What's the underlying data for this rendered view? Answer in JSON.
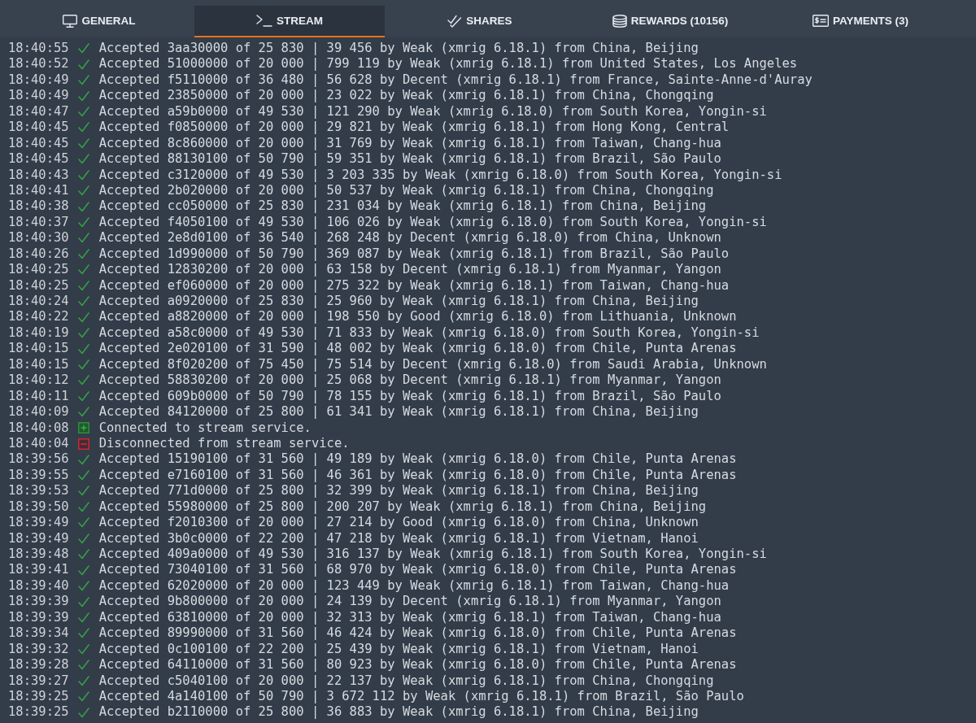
{
  "tabs": [
    {
      "label": "GENERAL",
      "selected": false
    },
    {
      "label": "STREAM",
      "selected": true
    },
    {
      "label": "SHARES",
      "selected": false
    },
    {
      "label": "REWARDS (10156)",
      "selected": false
    },
    {
      "label": "PAYMENTS (3)",
      "selected": false
    }
  ],
  "log": [
    {
      "time": "18:40:55",
      "kind": "accepted",
      "message": "Accepted 3aa30000 of 25 830 | 39 456 by Weak (xmrig 6.18.1) from China, Beijing"
    },
    {
      "time": "18:40:52",
      "kind": "accepted",
      "message": "Accepted 51000000 of 20 000 | 799 119 by Weak (xmrig 6.18.1) from United States, Los Angeles"
    },
    {
      "time": "18:40:49",
      "kind": "accepted",
      "message": "Accepted f5110000 of 36 480 | 56 628 by Decent (xmrig 6.18.1) from France, Sainte-Anne-d'Auray"
    },
    {
      "time": "18:40:49",
      "kind": "accepted",
      "message": "Accepted 23850000 of 20 000 | 23 022 by Weak (xmrig 6.18.1) from China, Chongqing"
    },
    {
      "time": "18:40:47",
      "kind": "accepted",
      "message": "Accepted a59b0000 of 49 530 | 121 290 by Weak (xmrig 6.18.0) from South Korea, Yongin-si"
    },
    {
      "time": "18:40:45",
      "kind": "accepted",
      "message": "Accepted f0850000 of 20 000 | 29 821 by Weak (xmrig 6.18.1) from Hong Kong, Central"
    },
    {
      "time": "18:40:45",
      "kind": "accepted",
      "message": "Accepted 8c860000 of 20 000 | 31 769 by Weak (xmrig 6.18.1) from Taiwan, Chang-hua"
    },
    {
      "time": "18:40:45",
      "kind": "accepted",
      "message": "Accepted 88130100 of 50 790 | 59 351 by Weak (xmrig 6.18.1) from Brazil, São Paulo"
    },
    {
      "time": "18:40:43",
      "kind": "accepted",
      "message": "Accepted c3120000 of 49 530 | 3 203 335 by Weak (xmrig 6.18.0) from South Korea, Yongin-si"
    },
    {
      "time": "18:40:41",
      "kind": "accepted",
      "message": "Accepted 2b020000 of 20 000 | 50 537 by Weak (xmrig 6.18.1) from China, Chongqing"
    },
    {
      "time": "18:40:38",
      "kind": "accepted",
      "message": "Accepted cc050000 of 25 830 | 231 034 by Weak (xmrig 6.18.1) from China, Beijing"
    },
    {
      "time": "18:40:37",
      "kind": "accepted",
      "message": "Accepted f4050100 of 49 530 | 106 026 by Weak (xmrig 6.18.0) from South Korea, Yongin-si"
    },
    {
      "time": "18:40:30",
      "kind": "accepted",
      "message": "Accepted 2e8d0100 of 36 540 | 268 248 by Decent (xmrig 6.18.0) from China, Unknown"
    },
    {
      "time": "18:40:26",
      "kind": "accepted",
      "message": "Accepted 1d990000 of 50 790 | 369 087 by Weak (xmrig 6.18.1) from Brazil, São Paulo"
    },
    {
      "time": "18:40:25",
      "kind": "accepted",
      "message": "Accepted 12830200 of 20 000 | 63 158 by Decent (xmrig 6.18.1) from Myanmar, Yangon"
    },
    {
      "time": "18:40:25",
      "kind": "accepted",
      "message": "Accepted ef060000 of 20 000 | 275 322 by Weak (xmrig 6.18.1) from Taiwan, Chang-hua"
    },
    {
      "time": "18:40:24",
      "kind": "accepted",
      "message": "Accepted a0920000 of 25 830 | 25 960 by Weak (xmrig 6.18.1) from China, Beijing"
    },
    {
      "time": "18:40:22",
      "kind": "accepted",
      "message": "Accepted a8820000 of 20 000 | 198 550 by Good (xmrig 6.18.0) from Lithuania, Unknown"
    },
    {
      "time": "18:40:19",
      "kind": "accepted",
      "message": "Accepted a58c0000 of 49 530 | 71 833 by Weak (xmrig 6.18.0) from South Korea, Yongin-si"
    },
    {
      "time": "18:40:15",
      "kind": "accepted",
      "message": "Accepted 2e020100 of 31 590 | 48 002 by Weak (xmrig 6.18.0) from Chile, Punta Arenas"
    },
    {
      "time": "18:40:15",
      "kind": "accepted",
      "message": "Accepted 8f020200 of 75 450 | 75 514 by Decent (xmrig 6.18.0) from Saudi Arabia, Unknown"
    },
    {
      "time": "18:40:12",
      "kind": "accepted",
      "message": "Accepted 58830200 of 20 000 | 25 068 by Decent (xmrig 6.18.1) from Myanmar, Yangon"
    },
    {
      "time": "18:40:11",
      "kind": "accepted",
      "message": "Accepted 609b0000 of 50 790 | 78 155 by Weak (xmrig 6.18.1) from Brazil, São Paulo"
    },
    {
      "time": "18:40:09",
      "kind": "accepted",
      "message": "Accepted 84120000 of 25 800 | 61 341 by Weak (xmrig 6.18.1) from China, Beijing"
    },
    {
      "time": "18:40:08",
      "kind": "connected",
      "message": "Connected to stream service."
    },
    {
      "time": "18:40:04",
      "kind": "disconnected",
      "message": "Disconnected from stream service."
    },
    {
      "time": "18:39:56",
      "kind": "accepted",
      "message": "Accepted 15190100 of 31 560 | 49 189 by Weak (xmrig 6.18.0) from Chile, Punta Arenas"
    },
    {
      "time": "18:39:55",
      "kind": "accepted",
      "message": "Accepted e7160100 of 31 560 | 46 361 by Weak (xmrig 6.18.0) from Chile, Punta Arenas"
    },
    {
      "time": "18:39:53",
      "kind": "accepted",
      "message": "Accepted 771d0000 of 25 800 | 32 399 by Weak (xmrig 6.18.1) from China, Beijing"
    },
    {
      "time": "18:39:50",
      "kind": "accepted",
      "message": "Accepted 55980000 of 25 800 | 200 207 by Weak (xmrig 6.18.1) from China, Beijing"
    },
    {
      "time": "18:39:49",
      "kind": "accepted",
      "message": "Accepted f2010300 of 20 000 | 27 214 by Good (xmrig 6.18.0) from China, Unknown"
    },
    {
      "time": "18:39:49",
      "kind": "accepted",
      "message": "Accepted 3b0c0000 of 22 200 | 47 218 by Weak (xmrig 6.18.1) from Vietnam, Hanoi"
    },
    {
      "time": "18:39:48",
      "kind": "accepted",
      "message": "Accepted 409a0000 of 49 530 | 316 137 by Weak (xmrig 6.18.1) from South Korea, Yongin-si"
    },
    {
      "time": "18:39:41",
      "kind": "accepted",
      "message": "Accepted 73040100 of 31 560 | 68 970 by Weak (xmrig 6.18.0) from Chile, Punta Arenas"
    },
    {
      "time": "18:39:40",
      "kind": "accepted",
      "message": "Accepted 62020000 of 20 000 | 123 449 by Weak (xmrig 6.18.1) from Taiwan, Chang-hua"
    },
    {
      "time": "18:39:39",
      "kind": "accepted",
      "message": "Accepted 9b800000 of 20 000 | 24 139 by Decent (xmrig 6.18.1) from Myanmar, Yangon"
    },
    {
      "time": "18:39:39",
      "kind": "accepted",
      "message": "Accepted 63810000 of 20 000 | 32 313 by Weak (xmrig 6.18.1) from Taiwan, Chang-hua"
    },
    {
      "time": "18:39:34",
      "kind": "accepted",
      "message": "Accepted 89990000 of 31 560 | 46 424 by Weak (xmrig 6.18.0) from Chile, Punta Arenas"
    },
    {
      "time": "18:39:32",
      "kind": "accepted",
      "message": "Accepted 0c100100 of 22 200 | 25 439 by Weak (xmrig 6.18.1) from Vietnam, Hanoi"
    },
    {
      "time": "18:39:28",
      "kind": "accepted",
      "message": "Accepted 64110000 of 31 560 | 80 923 by Weak (xmrig 6.18.0) from Chile, Punta Arenas"
    },
    {
      "time": "18:39:27",
      "kind": "accepted",
      "message": "Accepted c5040100 of 20 000 | 22 137 by Weak (xmrig 6.18.1) from China, Chongqing"
    },
    {
      "time": "18:39:25",
      "kind": "accepted",
      "message": "Accepted 4a140100 of 50 790 | 3 672 112 by Weak (xmrig 6.18.1) from Brazil, São Paulo"
    },
    {
      "time": "18:39:25",
      "kind": "accepted",
      "message": "Accepted b2110000 of 25 800 | 36 883 by Weak (xmrig 6.18.1) from China, Beijing"
    }
  ]
}
